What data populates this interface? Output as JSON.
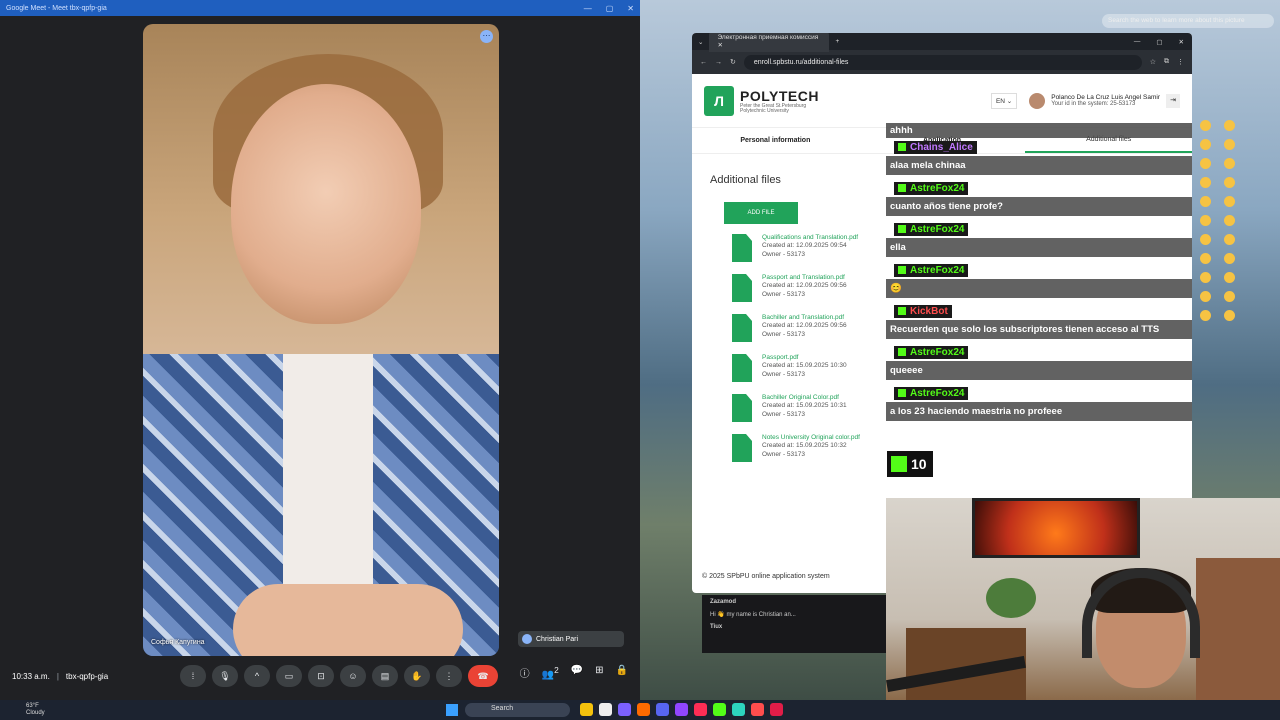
{
  "meet": {
    "window_title": "Google Meet - Meet tbx-qpfp-gia",
    "participant_name": "Софья Капугина",
    "self_name": "Christian Pari",
    "time": "10:33 a.m.",
    "meeting_code": "tbx-qpfp-gia",
    "participants_count": "2"
  },
  "taskbar": {
    "weather_temp": "63°F",
    "weather_cond": "Cloudy",
    "search_placeholder": "Search"
  },
  "desktop": {
    "hint": "Search the web to learn more about this picture"
  },
  "browser": {
    "tab_title": "Электронная приемная комиссия",
    "url": "enroll.spbstu.ru/additional-files"
  },
  "site": {
    "brand": "POLYTECH",
    "brand_sub": "Peter the Great St.Petersburg Polytechnic University",
    "lang": "EN",
    "user_name": "Polanco De La Cruz Luis Angel Samir",
    "user_id": "Your id in the system: 25-53173",
    "tabs": [
      "Personal information",
      "Application",
      "Additional files"
    ],
    "page_title": "Additional files",
    "add_file": "ADD FILE",
    "files": [
      {
        "name": "Qualifications and Translation.pdf",
        "created": "Created at: 12.09.2025 09:54",
        "owner": "Owner - 53173"
      },
      {
        "name": "Passport and Translation.pdf",
        "created": "Created at: 12.09.2025 09:56",
        "owner": "Owner - 53173"
      },
      {
        "name": "Bachiller and Translation.pdf",
        "created": "Created at: 12.09.2025 09:56",
        "owner": "Owner - 53173"
      },
      {
        "name": "Passport.pdf",
        "created": "Created at: 15.09.2025 10:30",
        "owner": "Owner - 53173"
      },
      {
        "name": "Bachiller Original Color.pdf",
        "created": "Created at: 15.09.2025 10:31",
        "owner": "Owner - 53173"
      },
      {
        "name": "Notes University Original color.pdf",
        "created": "Created at: 15.09.2025 10:32",
        "owner": "Owner - 53173"
      }
    ],
    "footer": "© 2025 SPbPU online application system"
  },
  "chat": {
    "first_line": "ahhh",
    "messages": [
      {
        "user": "Chains_Alice",
        "user_color": "#c179ff",
        "text": "alaa mela chinaa"
      },
      {
        "user": "AstreFox24",
        "user_color": "#53fc18",
        "text": "cuanto años tiene profe?"
      },
      {
        "user": "AstreFox24",
        "user_color": "#53fc18",
        "text": "ella"
      },
      {
        "user": "AstreFox24",
        "user_color": "#53fc18",
        "text": "😊"
      },
      {
        "user": "KickBot",
        "user_color": "#ff4d4d",
        "text": "Recuerden que solo los subscriptores tienen acceso al TTS"
      },
      {
        "user": "AstreFox24",
        "user_color": "#53fc18",
        "text": "queeee"
      },
      {
        "user": "AstreFox24",
        "user_color": "#53fc18",
        "text": "a los 23 haciendo maestria no profeee"
      }
    ],
    "viewer_count": "10"
  },
  "back_chat": {
    "user1": "Zazamod",
    "text1": "Hi 👋 my name is Christian an...",
    "user2": "Tiux"
  }
}
